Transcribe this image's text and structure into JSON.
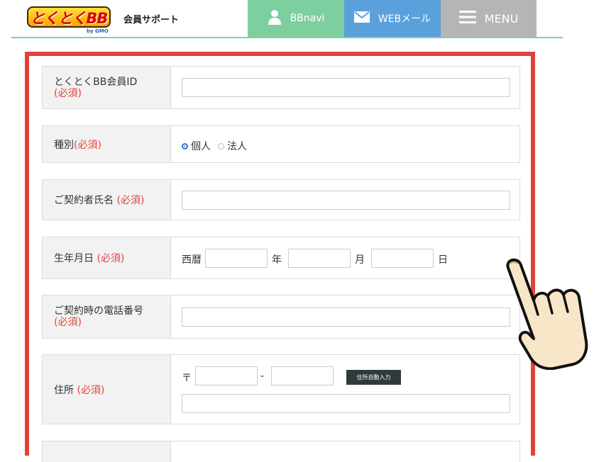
{
  "header": {
    "logo_text": "とくとくBB",
    "logo_by": "by GMO",
    "site_title": "会員サポート",
    "nav": [
      {
        "label": "BBnavi",
        "icon": "user-icon",
        "color": "#7ecfa0"
      },
      {
        "label": "WEBメール",
        "icon": "mail-icon",
        "color": "#5aa0dc"
      },
      {
        "label": "MENU",
        "icon": "hamburger-icon",
        "color": "#b5b5b5"
      }
    ]
  },
  "form": {
    "required_mark": "(必須)",
    "member_id": {
      "label": "とくとくBB会員ID",
      "value": ""
    },
    "type": {
      "label": "種別",
      "options": [
        "個人",
        "法人"
      ],
      "selected": "個人"
    },
    "contractor_name": {
      "label": "ご契約者氏名",
      "value": ""
    },
    "birthdate": {
      "label": "生年月日",
      "era": "西暦",
      "year_unit": "年",
      "month_unit": "月",
      "day_unit": "日"
    },
    "phone": {
      "label": "ご契約時の電話番号",
      "value": ""
    },
    "address": {
      "label": "住所",
      "postal_mark": "〒",
      "postal_sep": "-",
      "auto_button": "住所自動入力"
    }
  },
  "colors": {
    "accent_red": "#e2413a",
    "header_line": "#7fcfb0"
  }
}
